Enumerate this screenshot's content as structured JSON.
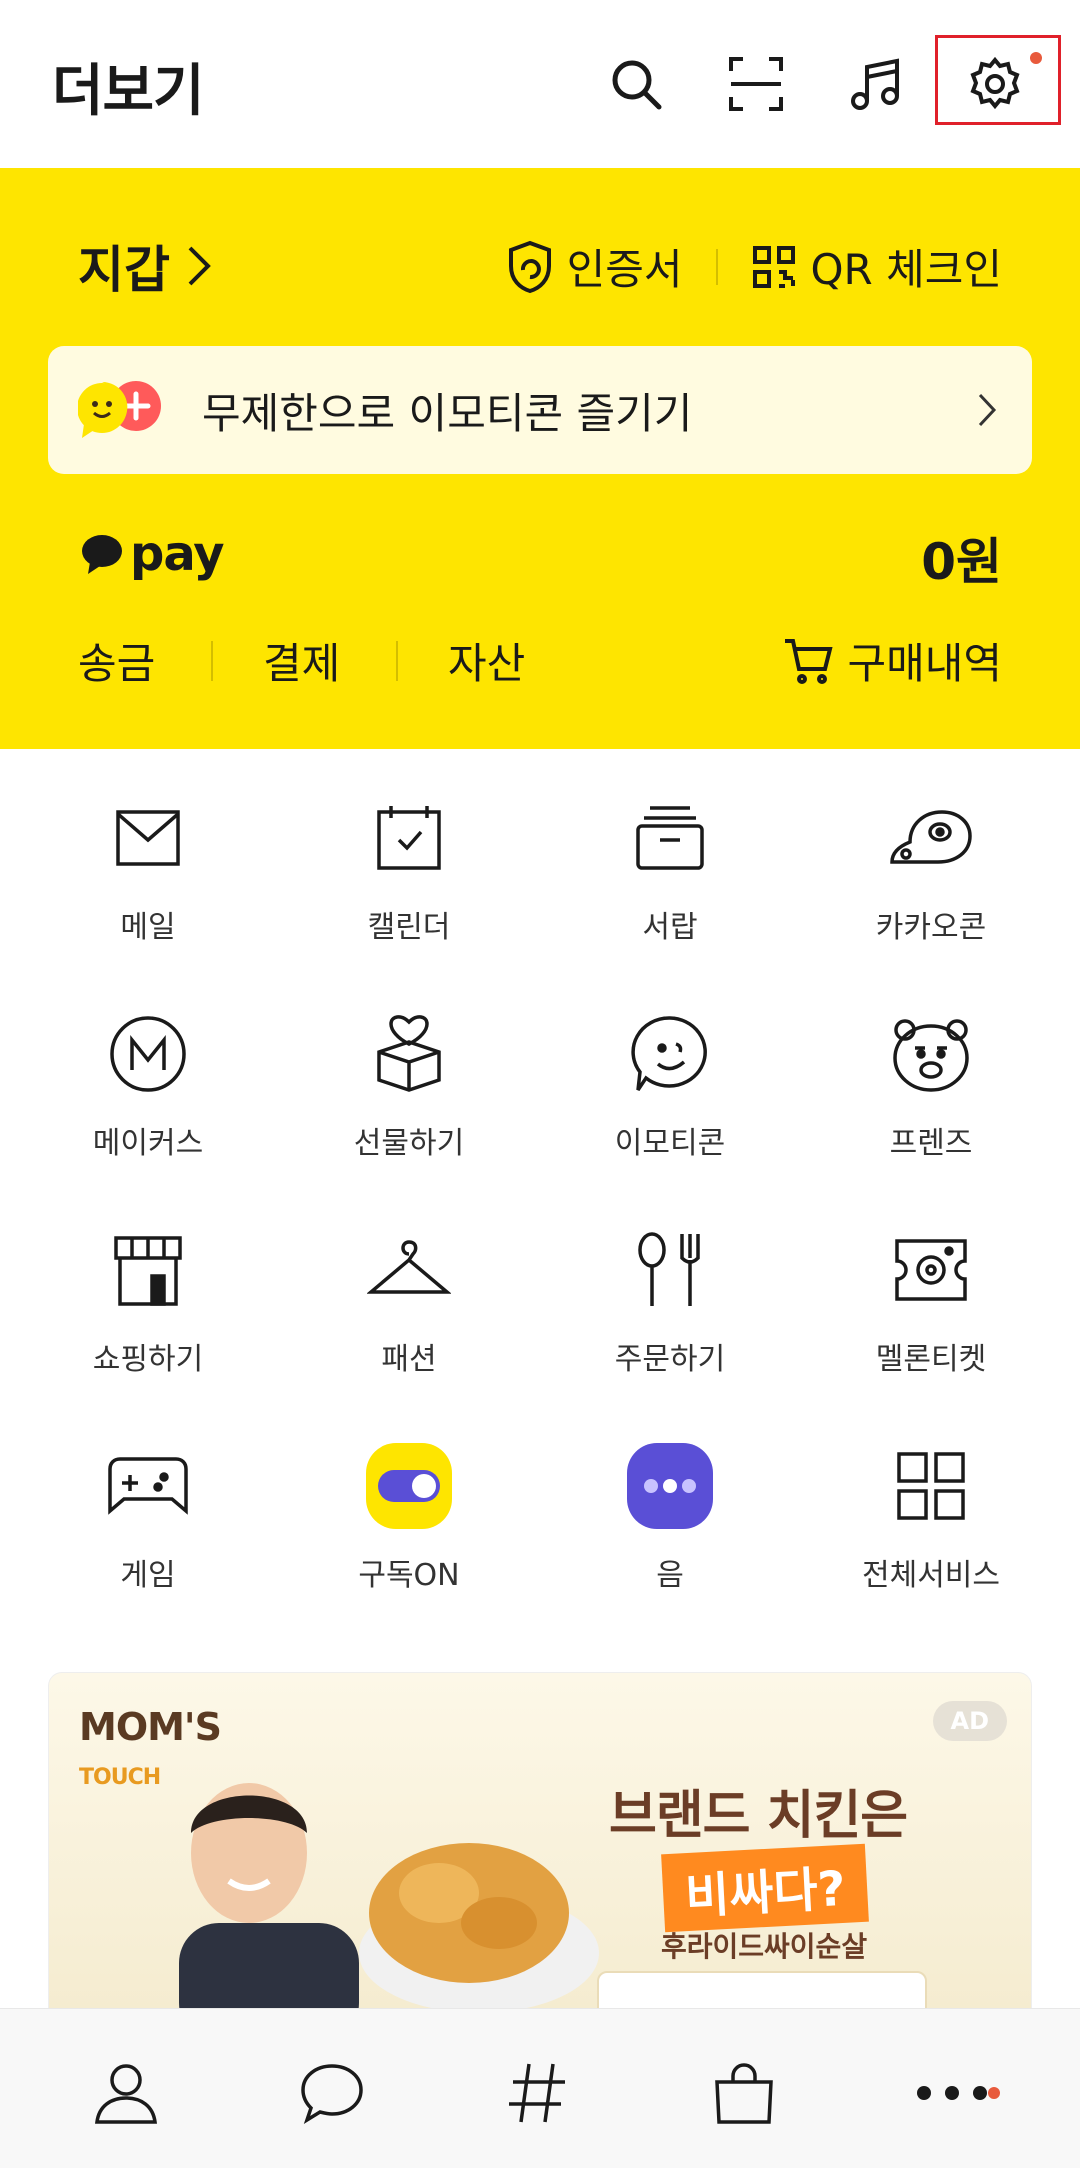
{
  "header": {
    "title": "더보기",
    "icons": [
      "search-icon",
      "scan-icon",
      "music-icon",
      "settings-icon"
    ]
  },
  "wallet": {
    "title": "지갑",
    "certificate_label": "인증서",
    "qr_label": "QR 체크인",
    "promo_text": "무제한으로 이모티콘 즐기기",
    "pay_label": "pay",
    "balance": "0원",
    "actions": [
      "송금",
      "결제",
      "자산"
    ],
    "purchase_history": "구매내역"
  },
  "grid": {
    "items": [
      {
        "label": "메일"
      },
      {
        "label": "캘린더"
      },
      {
        "label": "서랍"
      },
      {
        "label": "카카오콘"
      },
      {
        "label": "메이커스"
      },
      {
        "label": "선물하기"
      },
      {
        "label": "이모티콘"
      },
      {
        "label": "프렌즈"
      },
      {
        "label": "쇼핑하기"
      },
      {
        "label": "패션"
      },
      {
        "label": "주문하기"
      },
      {
        "label": "멜론티켓"
      },
      {
        "label": "게임"
      },
      {
        "label": "구독ON"
      },
      {
        "label": "음"
      },
      {
        "label": "전체서비스"
      }
    ]
  },
  "ad": {
    "badge": "AD",
    "brand": "MOM'S",
    "brand_sub": "TOUCH",
    "headline": "브랜드 치킨은",
    "highlight": "비싸다?",
    "subtext": "후라이드싸이순살"
  },
  "colors": {
    "accent_yellow": "#fee500",
    "notification_dot": "#e85a3c",
    "highlight_box": "#e0202a",
    "subscribe_purple": "#5a4fd6"
  }
}
